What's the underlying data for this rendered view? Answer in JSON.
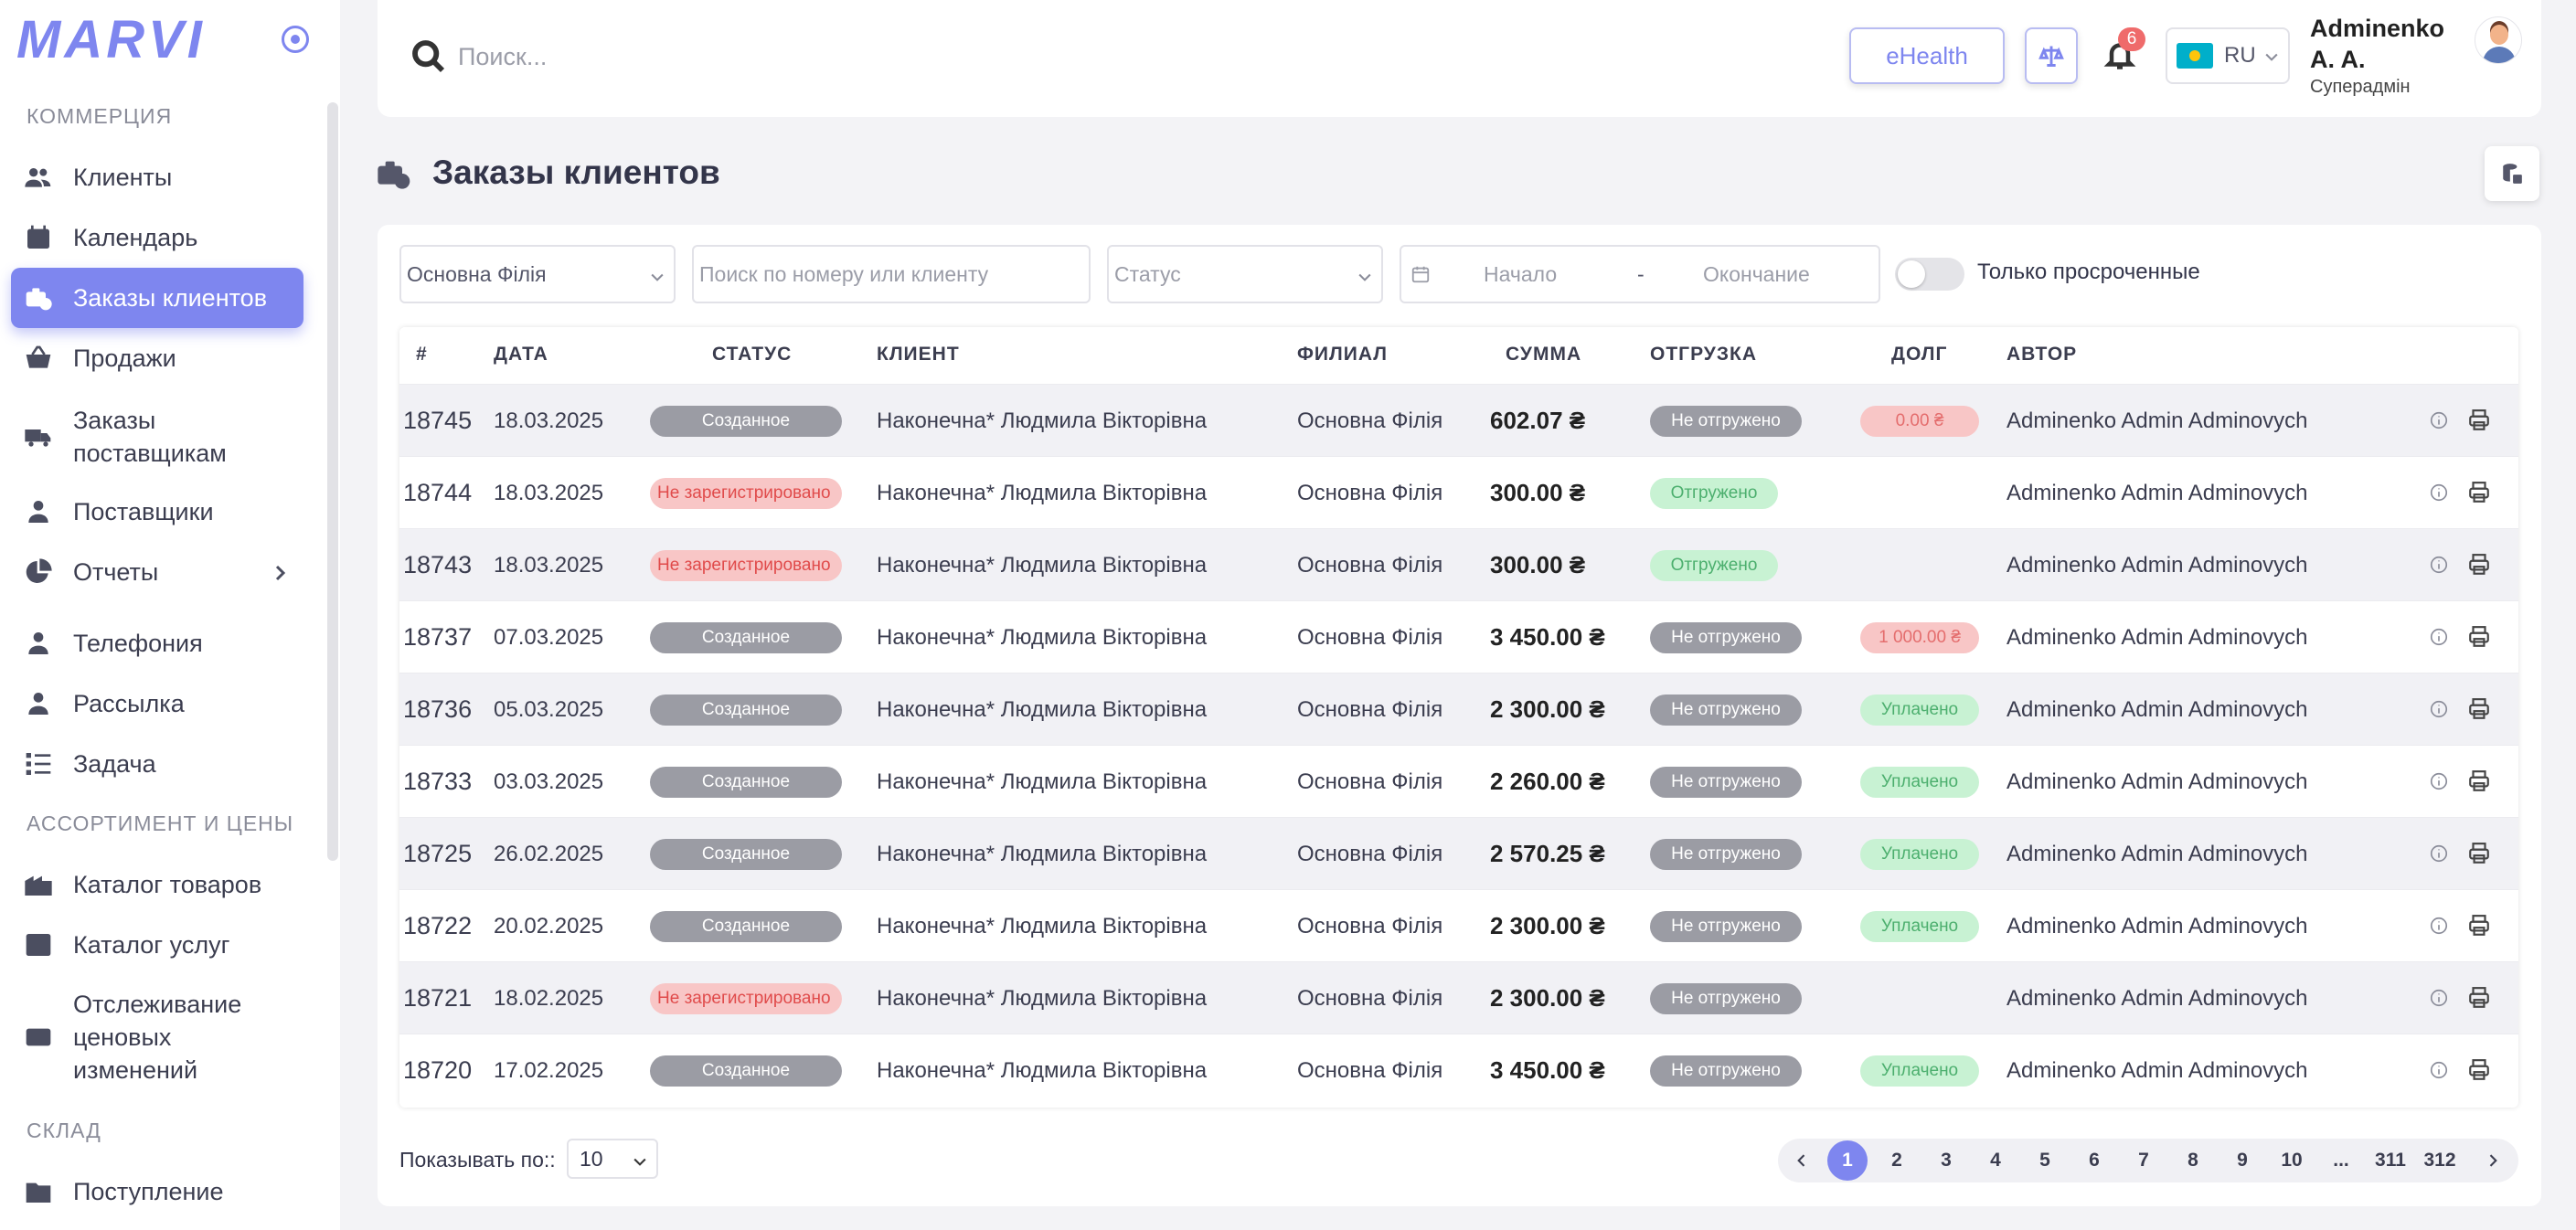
{
  "sidebar": {
    "logo": "MARVI",
    "sections": {
      "commerce": "КОММЕРЦИЯ",
      "assortment": "АССОРТИМЕНТ И ЦЕНЫ",
      "warehouse": "СКЛАД"
    },
    "items": {
      "clients": "Клиенты",
      "calendar": "Календарь",
      "orders": "Заказы клиентов",
      "sales": "Продажи",
      "supplier_orders_1": "Заказы",
      "supplier_orders_2": "поставщикам",
      "suppliers": "Поставщики",
      "reports": "Отчеты",
      "telephony": "Телефония",
      "mailing": "Рассылка",
      "tasks": "Задача",
      "goods_catalog": "Каталог товаров",
      "services_catalog": "Каталог услуг",
      "price_tracking_1": "Отслеживание",
      "price_tracking_2": "ценовых",
      "price_tracking_3": "изменений",
      "receipt": "Поступление"
    }
  },
  "header": {
    "search_placeholder": "Поиск...",
    "ehealth_label": "eHealth",
    "notifications_count": "6",
    "language": "RU",
    "user_name_1": "Adminenko",
    "user_name_2": "A. A.",
    "user_role": "Суперадмін"
  },
  "page": {
    "title": "Заказы клиентов"
  },
  "filters": {
    "branch": "Основна Філія",
    "search_placeholder": "Поиск по номеру или клиенту",
    "status_placeholder": "Статус",
    "date_start": "Начало",
    "date_sep": "-",
    "date_end": "Окончание",
    "overdue_only": "Только просроченные"
  },
  "table": {
    "headers": {
      "num": "#",
      "date": "ДАТА",
      "status": "СТАТУС",
      "client": "КЛИЕНТ",
      "branch": "ФИЛИАЛ",
      "sum": "СУММА",
      "shipment": "ОТГРУЗКА",
      "debt": "ДОЛГ",
      "author": "АВТОР"
    },
    "rows": [
      {
        "num": "18745",
        "date": "18.03.2025",
        "status": "Созданное",
        "status_type": "created",
        "client": "Наконечна* Людмила Вікторівна",
        "branch": "Основна Філія",
        "sum": "602.07 ₴",
        "shipment": "Не отгружено",
        "shipment_type": "noship",
        "debt": "0.00 ₴",
        "debt_type": "debt",
        "author": "Adminenko Admin Adminovych"
      },
      {
        "num": "18744",
        "date": "18.03.2025",
        "status": "Не зарегистрировано",
        "status_type": "notreg",
        "client": "Наконечна* Людмила Вікторівна",
        "branch": "Основна Філія",
        "sum": "300.00 ₴",
        "shipment": "Отгружено",
        "shipment_type": "shipped",
        "debt": "",
        "debt_type": "",
        "author": "Adminenko Admin Adminovych"
      },
      {
        "num": "18743",
        "date": "18.03.2025",
        "status": "Не зарегистрировано",
        "status_type": "notreg",
        "client": "Наконечна* Людмила Вікторівна",
        "branch": "Основна Філія",
        "sum": "300.00 ₴",
        "shipment": "Отгружено",
        "shipment_type": "shipped",
        "debt": "",
        "debt_type": "",
        "author": "Adminenko Admin Adminovych"
      },
      {
        "num": "18737",
        "date": "07.03.2025",
        "status": "Созданное",
        "status_type": "created",
        "client": "Наконечна* Людмила Вікторівна",
        "branch": "Основна Філія",
        "sum": "3 450.00 ₴",
        "shipment": "Не отгружено",
        "shipment_type": "noship",
        "debt": "1 000.00 ₴",
        "debt_type": "debt",
        "author": "Adminenko Admin Adminovych"
      },
      {
        "num": "18736",
        "date": "05.03.2025",
        "status": "Созданное",
        "status_type": "created",
        "client": "Наконечна* Людмила Вікторівна",
        "branch": "Основна Філія",
        "sum": "2 300.00 ₴",
        "shipment": "Не отгружено",
        "shipment_type": "noship",
        "debt": "Уплачено",
        "debt_type": "paid",
        "author": "Adminenko Admin Adminovych"
      },
      {
        "num": "18733",
        "date": "03.03.2025",
        "status": "Созданное",
        "status_type": "created",
        "client": "Наконечна* Людмила Вікторівна",
        "branch": "Основна Філія",
        "sum": "2 260.00 ₴",
        "shipment": "Не отгружено",
        "shipment_type": "noship",
        "debt": "Уплачено",
        "debt_type": "paid",
        "author": "Adminenko Admin Adminovych"
      },
      {
        "num": "18725",
        "date": "26.02.2025",
        "status": "Созданное",
        "status_type": "created",
        "client": "Наконечна* Людмила Вікторівна",
        "branch": "Основна Філія",
        "sum": "2 570.25 ₴",
        "shipment": "Не отгружено",
        "shipment_type": "noship",
        "debt": "Уплачено",
        "debt_type": "paid",
        "author": "Adminenko Admin Adminovych"
      },
      {
        "num": "18722",
        "date": "20.02.2025",
        "status": "Созданное",
        "status_type": "created",
        "client": "Наконечна* Людмила Вікторівна",
        "branch": "Основна Філія",
        "sum": "2 300.00 ₴",
        "shipment": "Не отгружено",
        "shipment_type": "noship",
        "debt": "Уплачено",
        "debt_type": "paid",
        "author": "Adminenko Admin Adminovych"
      },
      {
        "num": "18721",
        "date": "18.02.2025",
        "status": "Не зарегистрировано",
        "status_type": "notreg",
        "client": "Наконечна* Людмила Вікторівна",
        "branch": "Основна Філія",
        "sum": "2 300.00 ₴",
        "shipment": "Не отгружено",
        "shipment_type": "noship",
        "debt": "",
        "debt_type": "",
        "author": "Adminenko Admin Adminovych"
      },
      {
        "num": "18720",
        "date": "17.02.2025",
        "status": "Созданное",
        "status_type": "created",
        "client": "Наконечна* Людмила Вікторівна",
        "branch": "Основна Філія",
        "sum": "3 450.00 ₴",
        "shipment": "Не отгружено",
        "shipment_type": "noship",
        "debt": "Уплачено",
        "debt_type": "paid",
        "author": "Adminenko Admin Adminovych"
      }
    ]
  },
  "footer": {
    "per_page_label": "Показывать по::",
    "per_page_value": "10",
    "pages": [
      "1",
      "2",
      "3",
      "4",
      "5",
      "6",
      "7",
      "8",
      "9",
      "10",
      "...",
      "311",
      "312"
    ],
    "current_page": "1"
  },
  "colors": {
    "accent": "#7e86ef",
    "created": "#9b9ca4",
    "danger_bg": "#f8c6c6",
    "success_bg": "#c8f2d3"
  }
}
